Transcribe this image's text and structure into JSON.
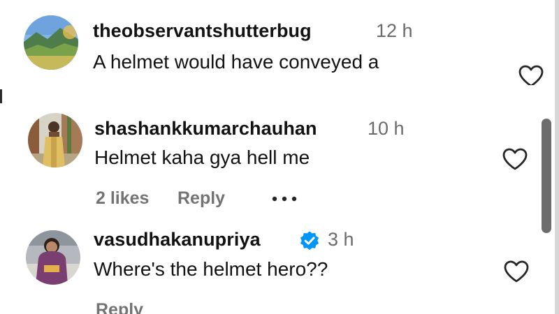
{
  "comments": [
    {
      "username": "theobservantshutterbug",
      "time": "12 h",
      "text": "A helmet would have conveyed a"
    },
    {
      "username": "shashankkumarchauhan",
      "time": "10 h",
      "text": "Helmet kaha gya hell me",
      "likes": "2 likes",
      "reply": "Reply"
    },
    {
      "username": "vasudhakanupriya",
      "time": "3 h",
      "text": "Where's the helmet hero??",
      "reply": "Reply",
      "verified": true
    }
  ],
  "icons": {
    "like": "heart-outline-icon",
    "more": "more-options-icon",
    "verified": "verified-badge-icon"
  },
  "colors": {
    "text": "#121212",
    "muted": "#737373",
    "verified": "#0095f6"
  }
}
